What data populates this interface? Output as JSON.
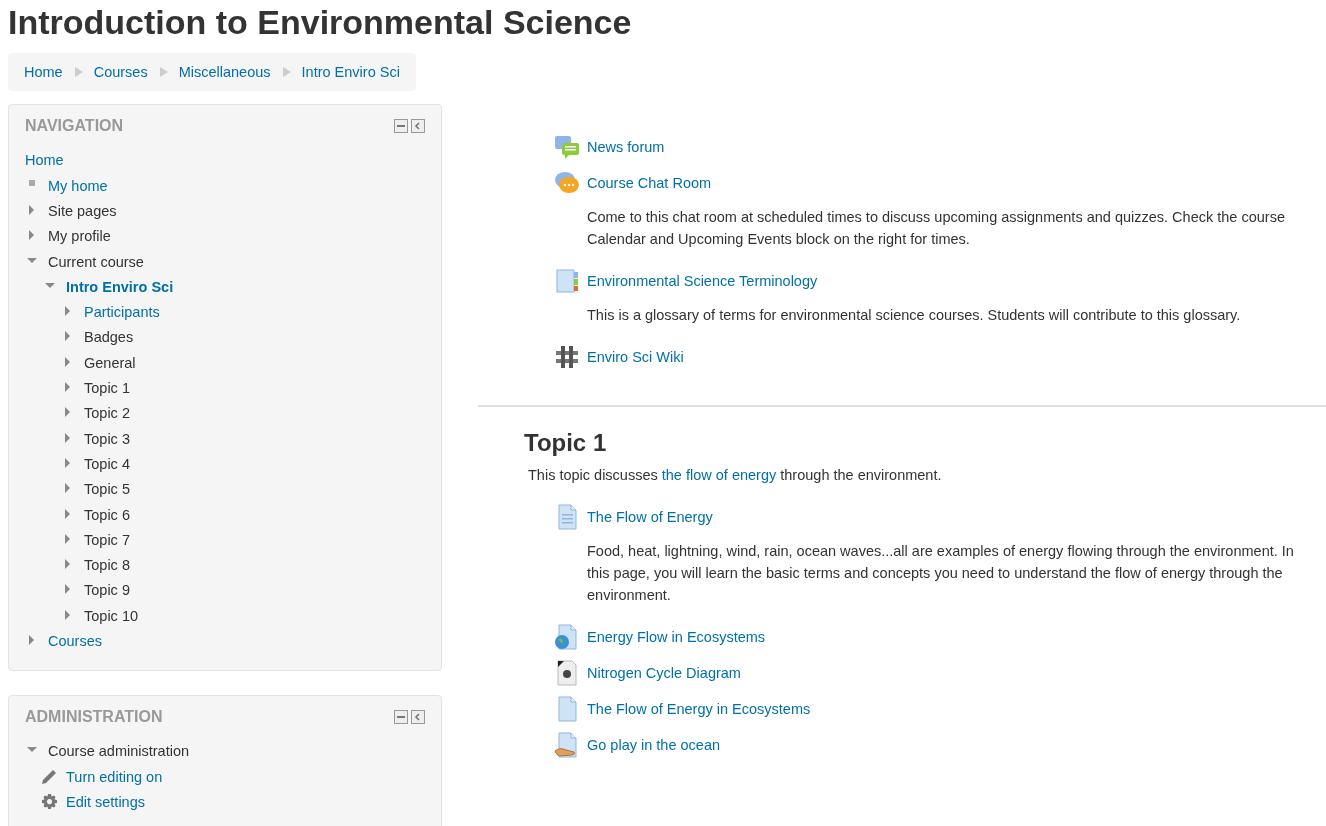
{
  "page_title": "Introduction to Environmental Science",
  "breadcrumb": [
    "Home",
    "Courses",
    "Miscellaneous",
    "Intro Enviro Sci"
  ],
  "navigation": {
    "title": "NAVIGATION",
    "home": "Home",
    "items": [
      {
        "label": "My home",
        "kind": "leaf",
        "link": true
      },
      {
        "label": "Site pages",
        "kind": "branch",
        "expanded": false,
        "link": false
      },
      {
        "label": "My profile",
        "kind": "branch",
        "expanded": false,
        "link": false
      },
      {
        "label": "Current course",
        "kind": "branch",
        "expanded": true,
        "link": false,
        "children": [
          {
            "label": "Intro Enviro Sci",
            "kind": "branch",
            "expanded": true,
            "link": true,
            "current": true,
            "children": [
              {
                "label": "Participants",
                "kind": "branch",
                "expanded": false,
                "link": true
              },
              {
                "label": "Badges",
                "kind": "branch",
                "expanded": false,
                "link": false
              },
              {
                "label": "General",
                "kind": "branch",
                "expanded": false,
                "link": false
              },
              {
                "label": "Topic 1",
                "kind": "branch",
                "expanded": false,
                "link": false
              },
              {
                "label": "Topic 2",
                "kind": "branch",
                "expanded": false,
                "link": false
              },
              {
                "label": "Topic 3",
                "kind": "branch",
                "expanded": false,
                "link": false
              },
              {
                "label": "Topic 4",
                "kind": "branch",
                "expanded": false,
                "link": false
              },
              {
                "label": "Topic 5",
                "kind": "branch",
                "expanded": false,
                "link": false
              },
              {
                "label": "Topic 6",
                "kind": "branch",
                "expanded": false,
                "link": false
              },
              {
                "label": "Topic 7",
                "kind": "branch",
                "expanded": false,
                "link": false
              },
              {
                "label": "Topic 8",
                "kind": "branch",
                "expanded": false,
                "link": false
              },
              {
                "label": "Topic 9",
                "kind": "branch",
                "expanded": false,
                "link": false
              },
              {
                "label": "Topic 10",
                "kind": "branch",
                "expanded": false,
                "link": false
              }
            ]
          }
        ]
      },
      {
        "label": "Courses",
        "kind": "branch",
        "expanded": false,
        "link": true
      }
    ]
  },
  "administration": {
    "title": "ADMINISTRATION",
    "items": [
      {
        "label": "Course administration",
        "kind": "branch",
        "expanded": true,
        "link": false,
        "children": [
          {
            "label": "Turn editing on",
            "kind": "pencil",
            "link": true
          },
          {
            "label": "Edit settings",
            "kind": "gear",
            "link": true
          }
        ]
      }
    ]
  },
  "general_section": {
    "activities": [
      {
        "kind": "forum",
        "name": "News forum"
      },
      {
        "kind": "chat",
        "name": "Course Chat Room",
        "description": "Come to this chat room at scheduled times to discuss upcoming assignments and quizzes. Check the course Calendar and Upcoming Events block on the right for times."
      },
      {
        "kind": "glossary",
        "name": "Environmental Science Terminology",
        "description": "This is a glossary of terms for environmental science courses. Students will contribute to this glossary."
      },
      {
        "kind": "wiki",
        "name": "Enviro Sci Wiki"
      }
    ]
  },
  "topic_1": {
    "title": "Topic 1",
    "summary": {
      "before": "This topic discusses ",
      "link": "the flow of energy",
      "after": " through the environment."
    },
    "activities": [
      {
        "kind": "page",
        "name": "The Flow of Energy",
        "description": "Food, heat, lightning, wind, rain, ocean waves...all are examples of energy flowing through the environment. In this page, you will learn the basic terms and concepts you need to understand the flow of energy through the environment."
      },
      {
        "kind": "url",
        "name": "Energy Flow in Ecosystems"
      },
      {
        "kind": "image",
        "name": "Nitrogen Cycle Diagram"
      },
      {
        "kind": "file",
        "name": "The Flow of Energy in Ecosystems"
      },
      {
        "kind": "hand",
        "name": "Go play in the ocean"
      }
    ]
  }
}
